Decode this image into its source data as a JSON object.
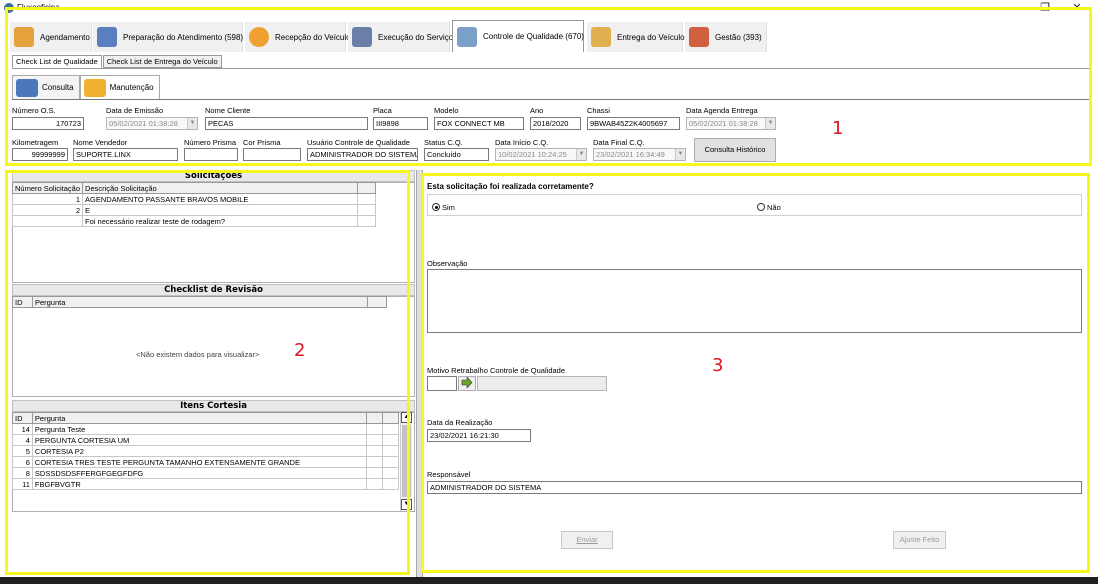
{
  "window": {
    "title": "Fluxooficina"
  },
  "window_controls": {
    "minimize": "–",
    "restore": "❐",
    "close": "✕"
  },
  "tabs": [
    {
      "label": "Agendamento",
      "icon": "person-icon",
      "color": "#e6a23c"
    },
    {
      "label": "Preparação do Atendimento (598)",
      "icon": "form-icon",
      "color": "#5b7fbe"
    },
    {
      "label": "Recepção do Veículo",
      "icon": "location-pin-icon",
      "color": "#f0a030"
    },
    {
      "label": "Execução do Serviço",
      "icon": "mechanic-icon",
      "color": "#6a7fa8"
    },
    {
      "label": "Controle de Qualidade (670)",
      "icon": "quality-check-icon",
      "color": "#7aa0c8",
      "active": true
    },
    {
      "label": "Entrega do Veículo",
      "icon": "hourglass-icon",
      "color": "#e0b050"
    },
    {
      "label": "Gestão (393)",
      "icon": "chart-icon",
      "color": "#d06040"
    }
  ],
  "subtabs": [
    {
      "label": "Check List de Qualidade",
      "active": true
    },
    {
      "label": "Check List de Entrega do Veículo"
    }
  ],
  "modetabs": [
    {
      "label": "Consulta",
      "icon": "binoculars-icon"
    },
    {
      "label": "Manutenção",
      "icon": "pencil-icon",
      "active": true
    }
  ],
  "header_fields": {
    "numero_os": {
      "label": "Número O.S.",
      "value": "170723"
    },
    "data_emissao": {
      "label": "Data de Emissão",
      "value": "05/02/2021 01:38:28"
    },
    "nome_cliente": {
      "label": "Nome Cliente",
      "value": "PECAS"
    },
    "placa": {
      "label": "Placa",
      "value": "III9898"
    },
    "modelo": {
      "label": "Modelo",
      "value": "FOX CONNECT MB"
    },
    "ano": {
      "label": "Ano",
      "value": "2018/2020"
    },
    "chassi": {
      "label": "Chassi",
      "value": "9BWAB45Z2K4005697"
    },
    "data_agenda_entrega": {
      "label": "Data Agenda Entrega",
      "value": "05/02/2021 01:38:28"
    },
    "kilometragem": {
      "label": "Kilometragem",
      "value": "99999999"
    },
    "nome_vendedor": {
      "label": "Nome Vendedor",
      "value": "SUPORTE.LINX"
    },
    "numero_prisma": {
      "label": "Número Prisma",
      "value": ""
    },
    "cor_prisma": {
      "label": "Cor Prisma",
      "value": ""
    },
    "usuario_cq": {
      "label": "Usuário Controle de Qualidade",
      "value": "ADMINISTRADOR DO SISTEMA"
    },
    "status_cq": {
      "label": "Status C.Q.",
      "value": "Concluído"
    },
    "data_inicio_cq": {
      "label": "Data Início C.Q.",
      "value": "10/02/2021 10:24:25"
    },
    "data_final_cq": {
      "label": "Data Final C.Q.",
      "value": "23/02/2021 16:34:49"
    },
    "consulta_historico": "Consulta Histórico"
  },
  "solicitacoes": {
    "title": "Solicitações",
    "columns": [
      "Número Solicitação",
      "Descrição Solicitação"
    ],
    "rows": [
      {
        "num": "1",
        "desc": "AGENDAMENTO PASSANTE BRAVOS MOBILE"
      },
      {
        "num": "2",
        "desc": "E"
      },
      {
        "num": "",
        "desc": "Foi necessário realizar teste de rodagem?"
      }
    ]
  },
  "checklist_revisao": {
    "title": "Checklist de Revisão",
    "columns": [
      "ID",
      "Pergunta"
    ],
    "empty_text": "<Não existem dados para visualizar>"
  },
  "itens_cortesia": {
    "title": "Itens Cortesia",
    "columns": [
      "ID",
      "Pergunta"
    ],
    "rows": [
      {
        "id": "14",
        "q": "Pergunta Teste"
      },
      {
        "id": "4",
        "q": "PERGUNTA CORTESIA UM"
      },
      {
        "id": "5",
        "q": "CORTESIA P2"
      },
      {
        "id": "6",
        "q": "CORTESIA TRES TESTE PERGUNTA TAMANHO EXTENSAMENTE GRANDE"
      },
      {
        "id": "8",
        "q": "SDSSDSDSFFERGFGEGFDFG"
      },
      {
        "id": "11",
        "q": "FBGFBVGTR"
      }
    ],
    "scroll_up": "▲",
    "scroll_down": "▼"
  },
  "right_panel": {
    "question": "Esta solicitação foi realizada corretamente?",
    "option_yes": "Sim",
    "option_no": "Não",
    "selected": "Sim",
    "observacao_label": "Observação",
    "observacao_value": "",
    "motivo_label": "Motivo Retrabalho Controle de Qualidade",
    "motivo_value": "",
    "data_realizacao_label": "Data da Realização",
    "data_realizacao_value": "23/02/2021 16:21:30",
    "responsavel_label": "Responsável",
    "responsavel_value": "ADMINISTRADOR DO SISTEMA",
    "enviar": "Enviar",
    "ajuste_feito": "Ajuste Feito"
  },
  "annotations": {
    "one": "1",
    "two": "2",
    "three": "3",
    "highlight_color": "#f7f71e",
    "number_color": "#e0141e"
  }
}
